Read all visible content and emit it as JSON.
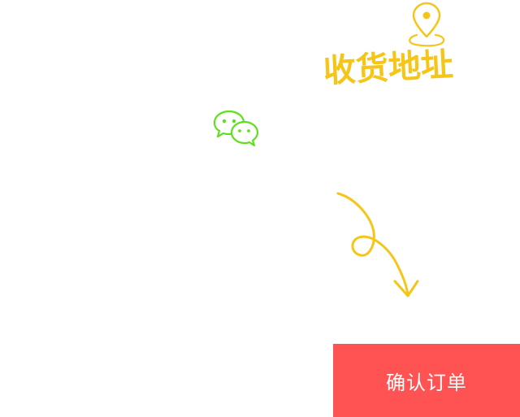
{
  "address": {
    "label": "收货地址",
    "icon": "location-pin-icon",
    "color": "#f5c518"
  },
  "share": {
    "icon": "wechat-icon",
    "color": "#5fe01f"
  },
  "hint": {
    "icon": "curved-arrow-icon",
    "color": "#f5c518"
  },
  "footer": {
    "confirm_label": "确认订单",
    "confirm_bg": "#ff5353"
  }
}
